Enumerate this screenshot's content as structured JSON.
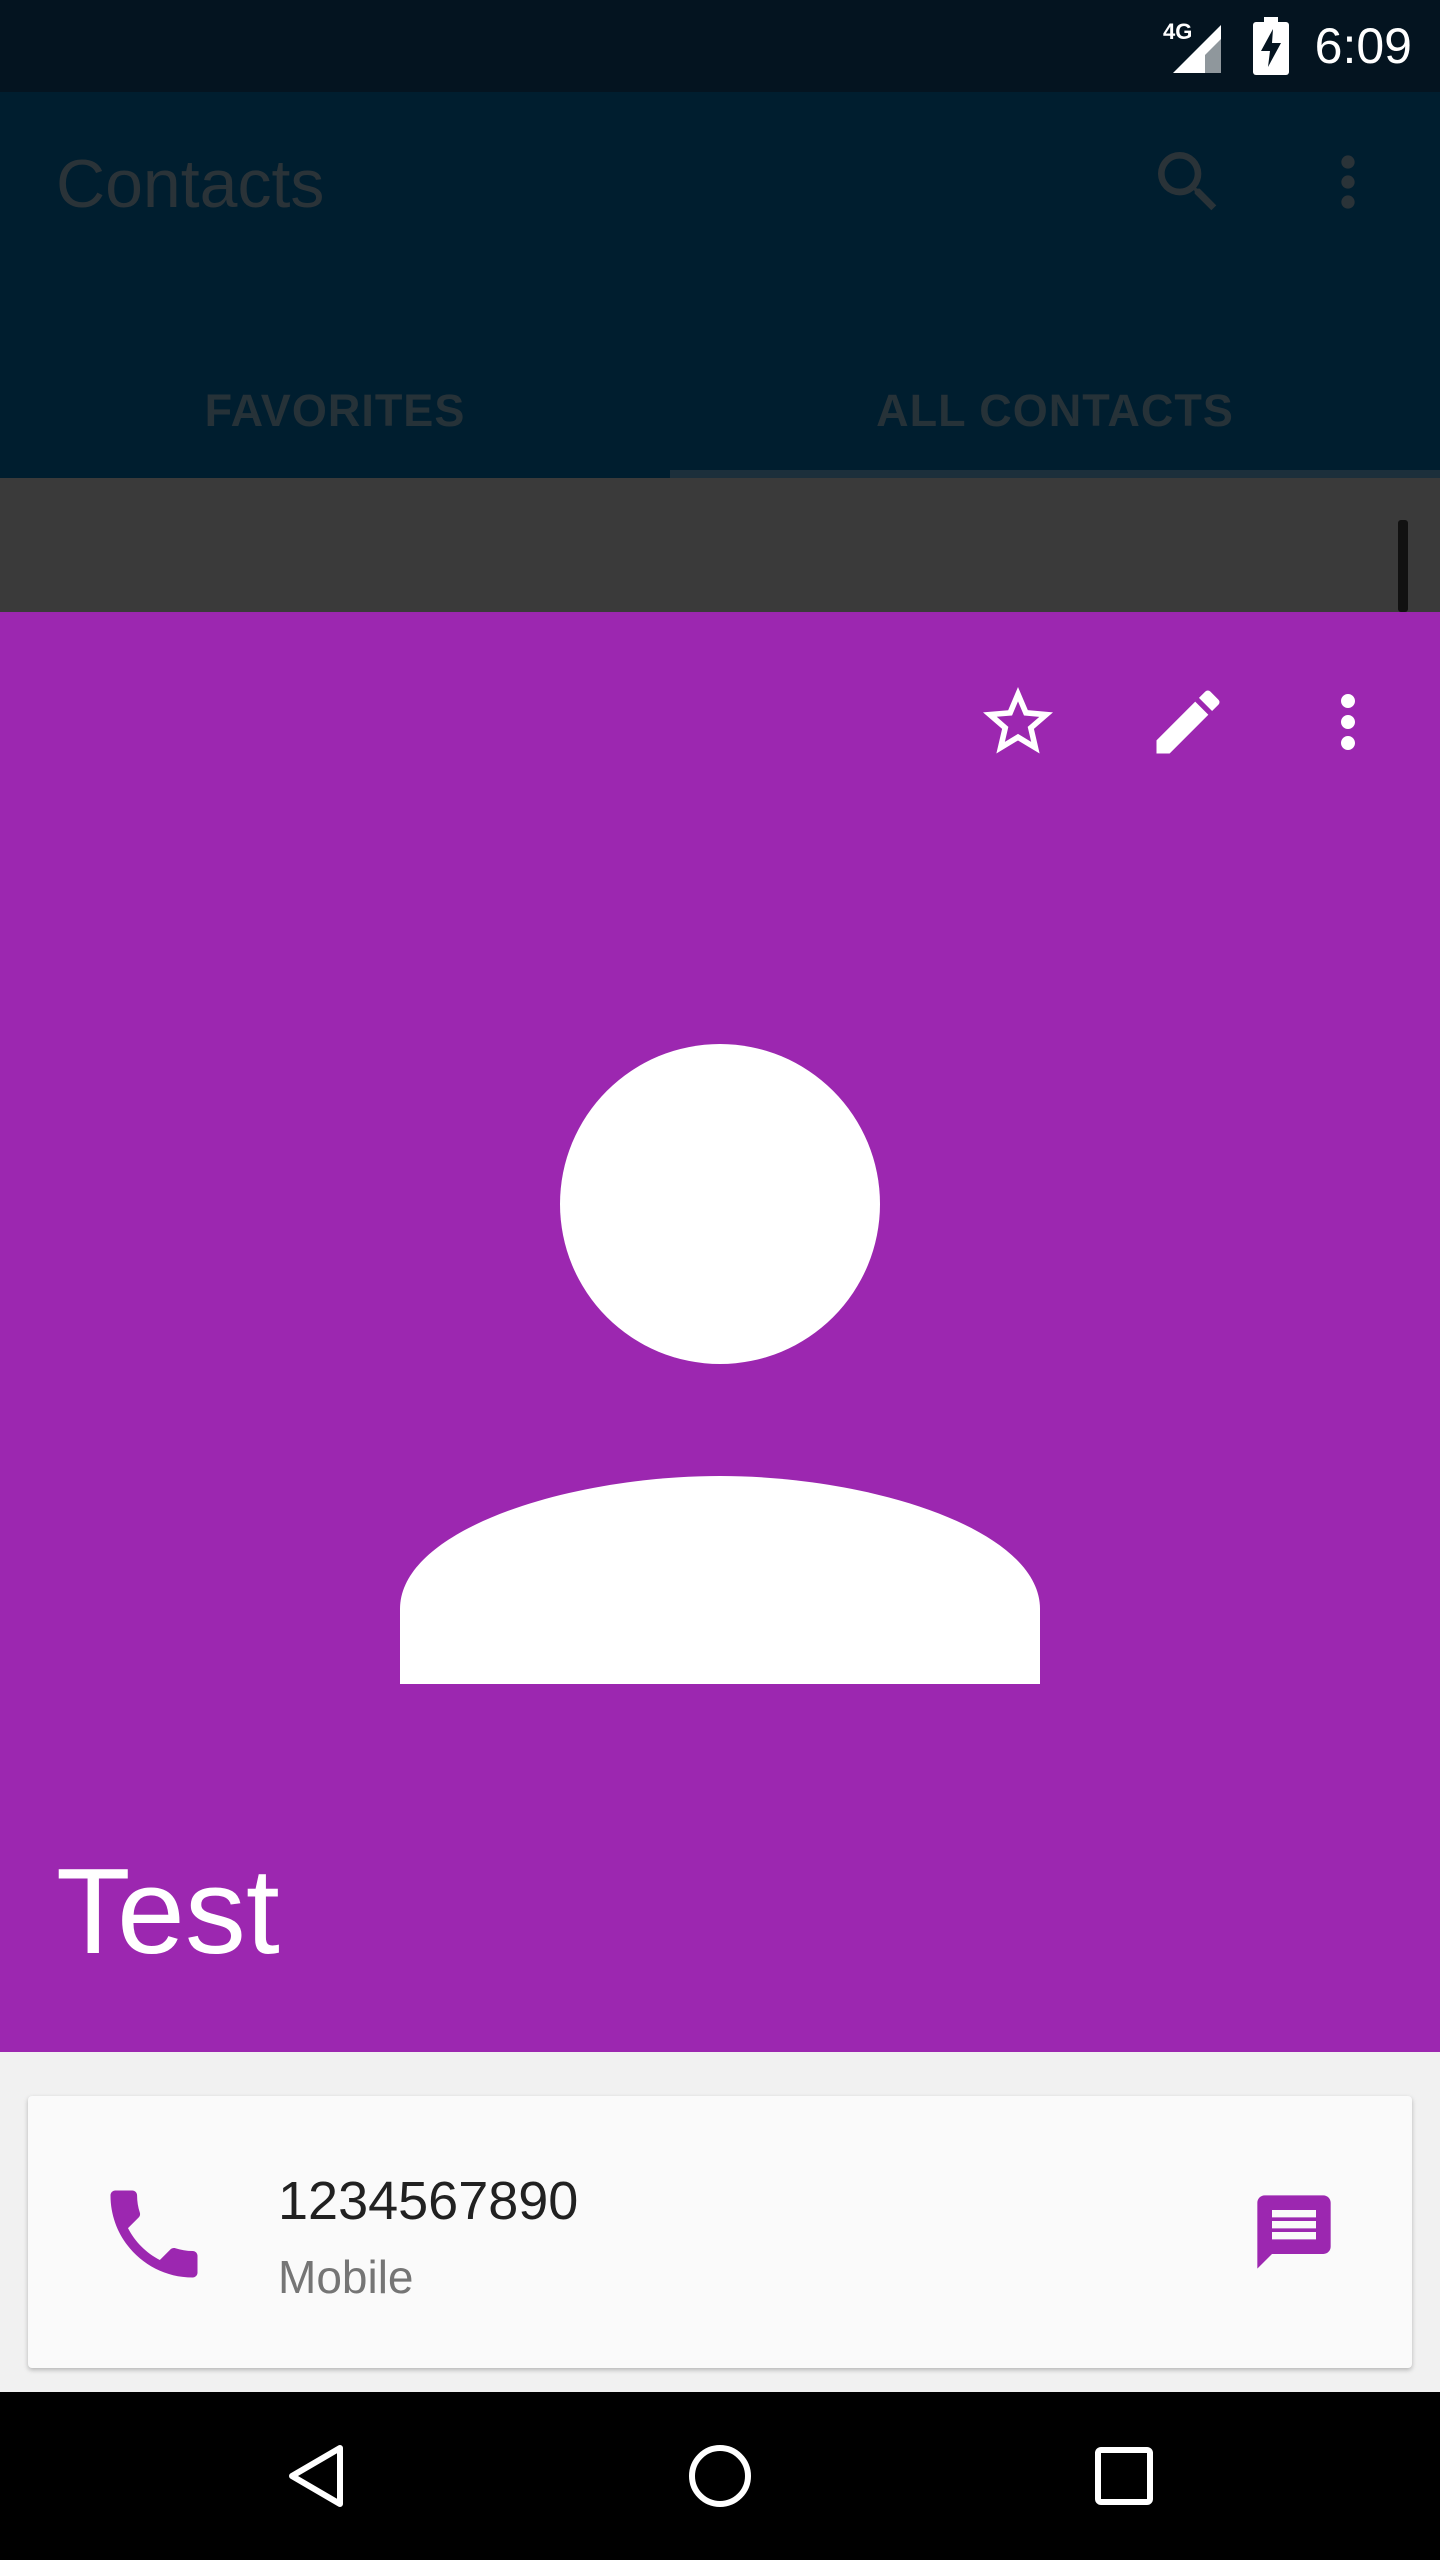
{
  "status_bar": {
    "network_label": "4G",
    "time": "6:09",
    "icons": [
      "network-4g-icon",
      "signal-icon",
      "battery-charging-icon"
    ]
  },
  "app_bar": {
    "title": "Contacts",
    "tabs": [
      {
        "label": "FAVORITES",
        "selected": false
      },
      {
        "label": "ALL CONTACTS",
        "selected": true
      }
    ],
    "icons": [
      "search-icon",
      "more-vert-icon"
    ]
  },
  "contact": {
    "name": "Test",
    "header_color": "#9c27b0",
    "actions": [
      "star-outline-icon",
      "edit-icon",
      "more-vert-icon"
    ],
    "avatar_icon": "person-placeholder-icon",
    "phone": {
      "number": "1234567890",
      "type": "Mobile",
      "call_icon": "phone-icon",
      "message_icon": "message-icon"
    }
  },
  "nav_bar": {
    "buttons": [
      "back-icon",
      "home-icon",
      "recents-icon"
    ]
  }
}
